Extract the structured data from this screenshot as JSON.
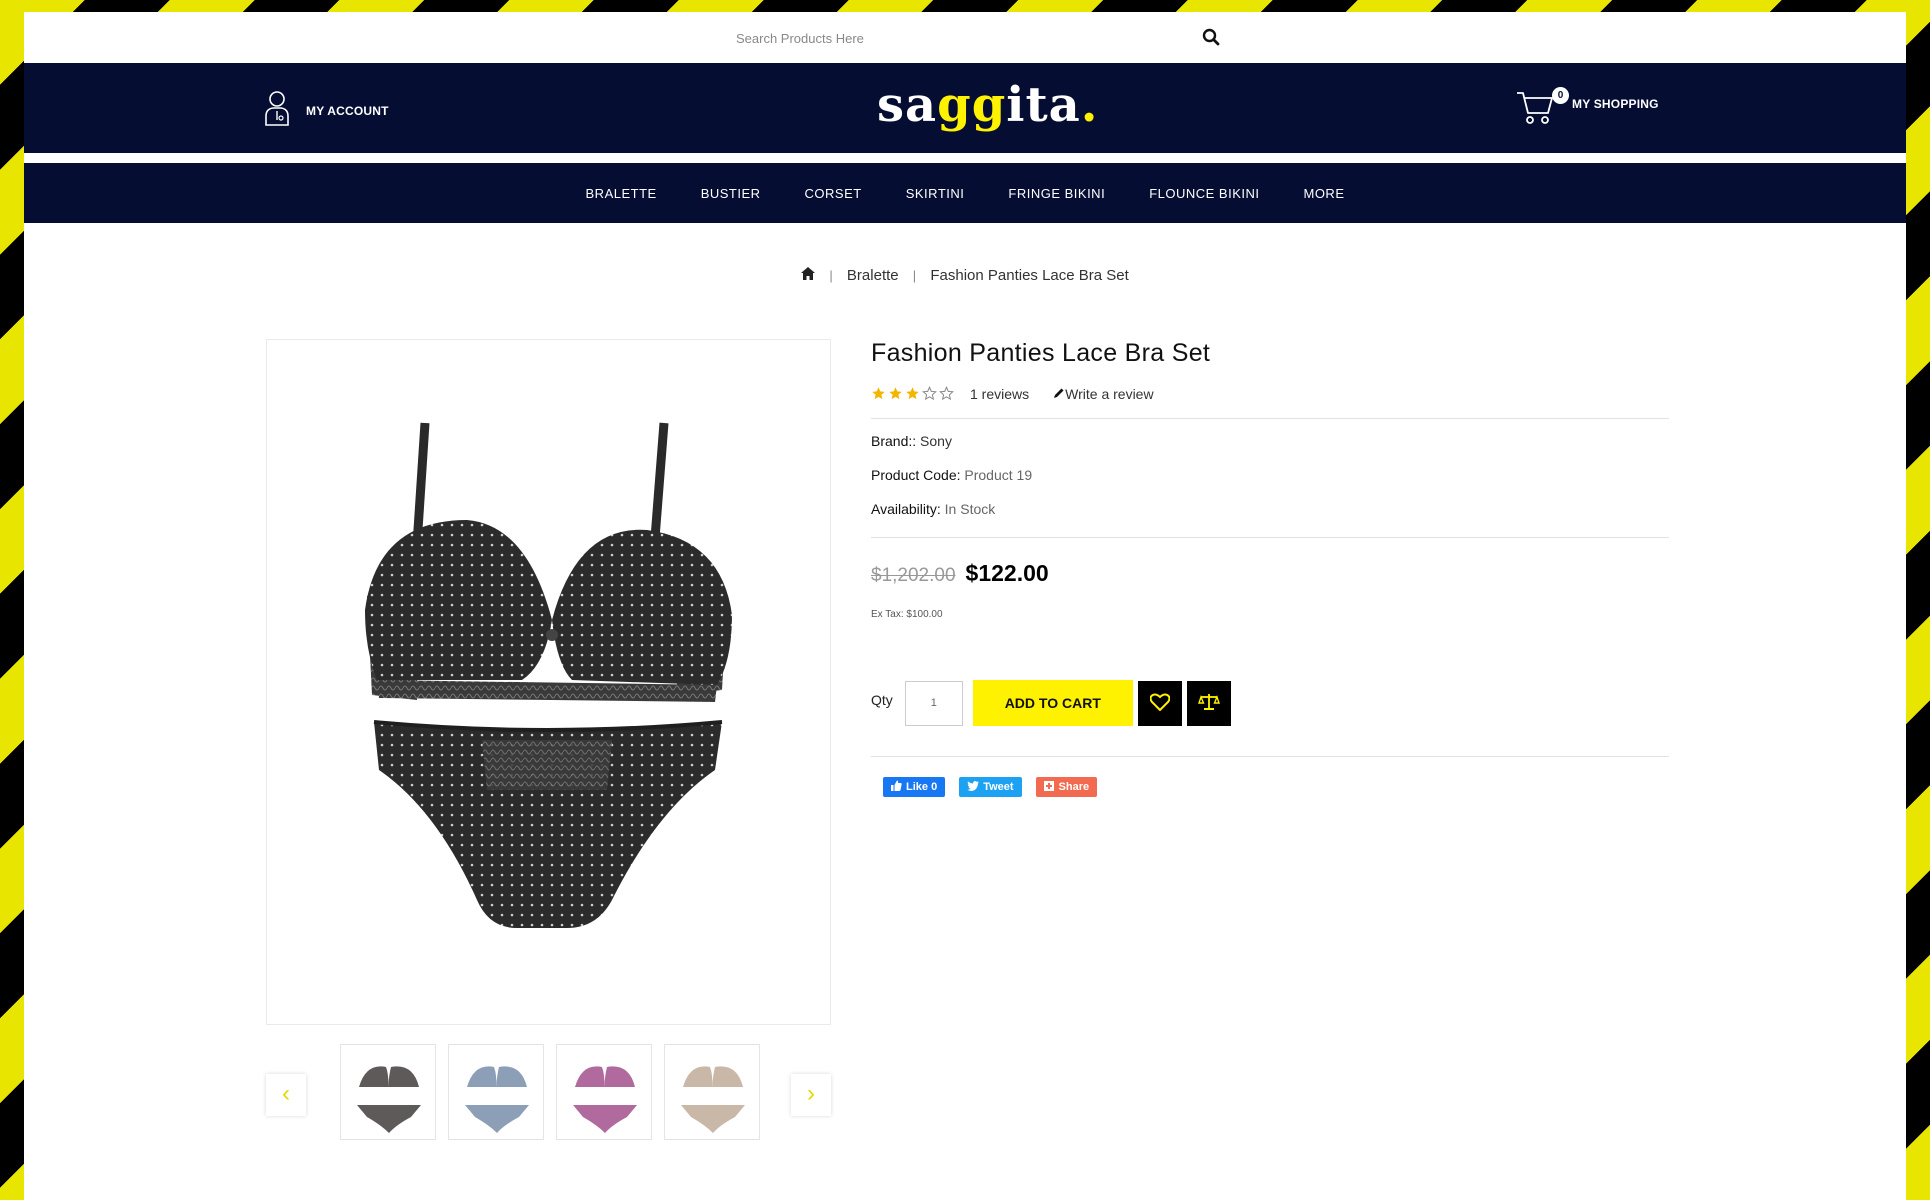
{
  "search": {
    "placeholder": "Search Products Here"
  },
  "header": {
    "account_label": "MY ACCOUNT",
    "logo": {
      "part1": "sa",
      "part2": "gg",
      "part3": "ita",
      "dot": "."
    },
    "cart_label": "MY SHOPPING",
    "cart_count": "0"
  },
  "nav": {
    "items": [
      "BRALETTE",
      "BUSTIER",
      "CORSET",
      "SKIRTINI",
      "FRINGE BIKINI",
      "FLOUNCE BIKINI",
      "MORE"
    ]
  },
  "breadcrumb": {
    "home_icon": "home-icon",
    "separator": "|",
    "items": [
      "Bralette",
      "Fashion Panties Lace Bra Set"
    ]
  },
  "product": {
    "title": "Fashion Panties Lace Bra Set",
    "rating": 3,
    "rating_max": 5,
    "reviews_text": "1 reviews",
    "write_review": "Write a review",
    "brand_label": "Brand::",
    "brand_value": "Sony",
    "code_label": "Product Code:",
    "code_value": "Product 19",
    "availability_label": "Availability:",
    "availability_value": "In Stock",
    "old_price": "$1,202.00",
    "new_price": "$122.00",
    "ex_tax": "Ex Tax: $100.00",
    "qty_label": "Qty",
    "qty_value": "1",
    "add_to_cart": "ADD TO CART",
    "thumb_colors": [
      "#5e5a5a",
      "#8d9fb6",
      "#b06a9e",
      "#c9b7a8"
    ]
  },
  "social": {
    "like": "Like 0",
    "tweet": "Tweet",
    "share": "Share"
  },
  "colors": {
    "navy": "#050d33",
    "accent_yellow": "#fff200",
    "star_gold": "#f2b600",
    "facebook": "#1877f2",
    "twitter": "#1da1f2",
    "share": "#f26a4f"
  }
}
